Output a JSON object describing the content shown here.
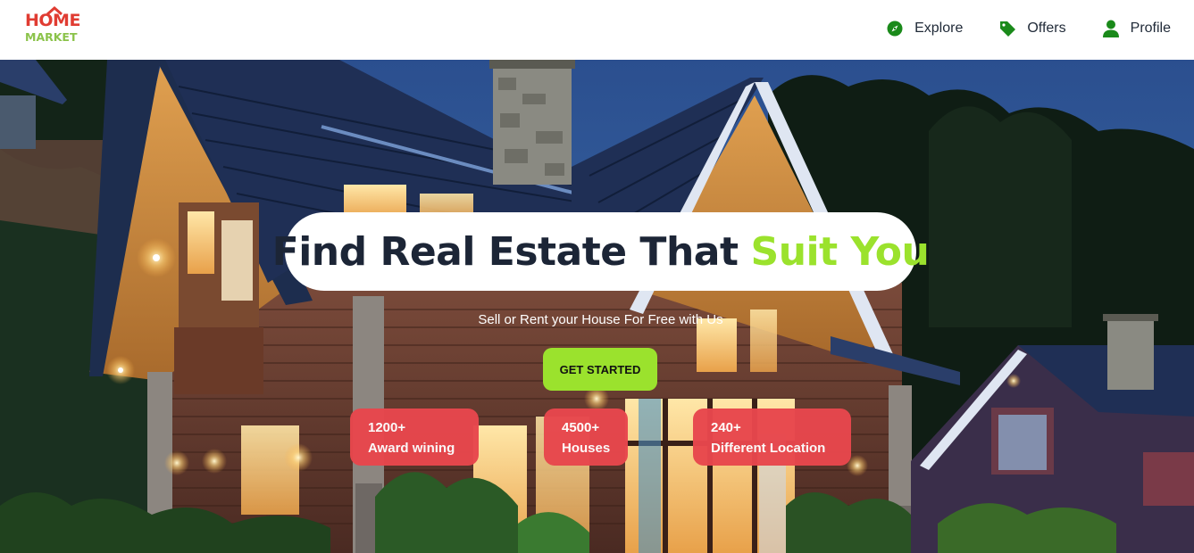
{
  "brand": {
    "logo_line1": "HOME",
    "logo_line2": "MARKET",
    "colors": {
      "home": "#e03c32",
      "market": "#8bc34a"
    }
  },
  "nav": {
    "items": [
      {
        "label": "Explore",
        "icon": "compass-icon"
      },
      {
        "label": "Offers",
        "icon": "tag-icon"
      },
      {
        "label": "Profile",
        "icon": "user-icon"
      }
    ],
    "icon_color": "#1a8a1a"
  },
  "hero": {
    "title_main": "Find Real Estate That",
    "title_accent": "Suit You",
    "subtitle": "Sell or Rent your House For Free with Us",
    "cta_label": "GET STARTED",
    "accent_color": "#9be22d",
    "stats": [
      {
        "value": "1200+",
        "label": "Award wining"
      },
      {
        "value": "4500+",
        "label": "Houses"
      },
      {
        "value": "240+",
        "label": "Different Location"
      }
    ],
    "stat_color": "#e8474d"
  }
}
